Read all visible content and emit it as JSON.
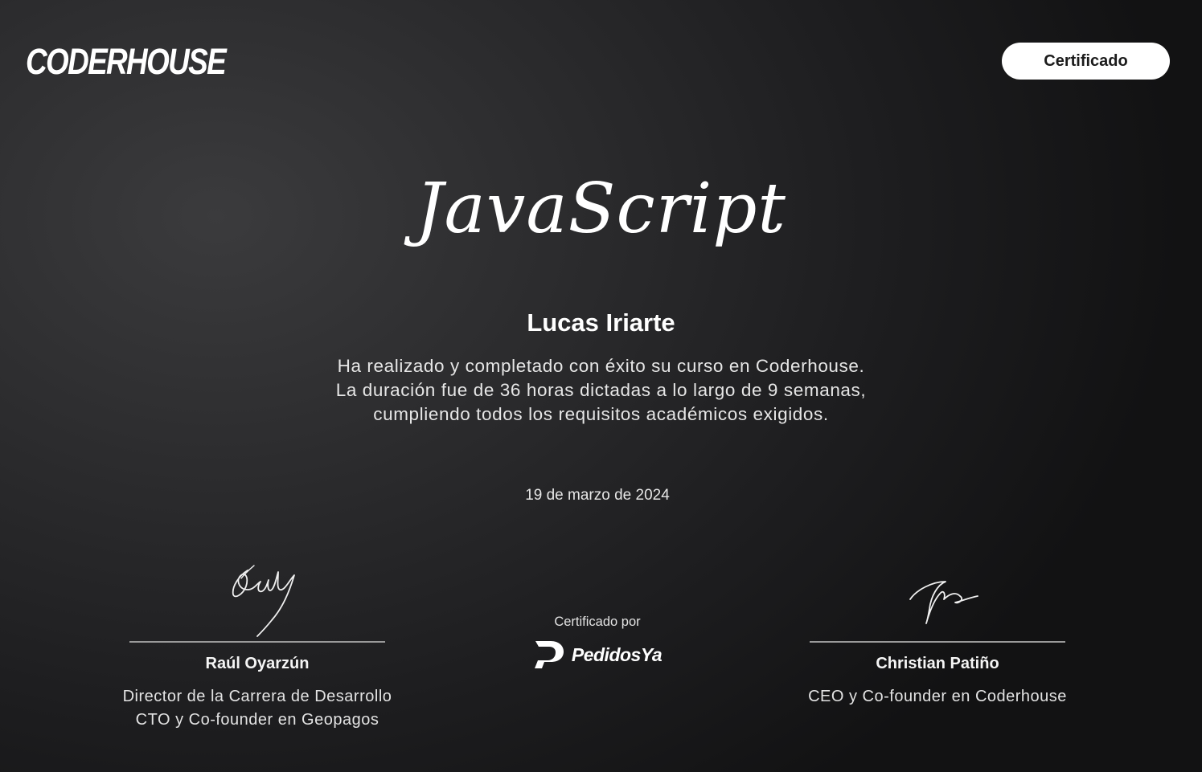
{
  "header": {
    "logo_text": "CODERHOUSE",
    "badge_label": "Certificado"
  },
  "certificate": {
    "course": "JavaScript",
    "student_name": "Lucas Iriarte",
    "description_lines": [
      "Ha realizado y completado con éxito su curso en Coderhouse.",
      "La duración fue de 36 horas dictadas a lo largo de 9 semanas,",
      "cumpliendo todos los requisitos académicos exigidos."
    ],
    "date": "19 de marzo de 2024"
  },
  "signatories": [
    {
      "name": "Raúl Oyarzún",
      "roles": [
        "Director de la Carrera de Desarrollo",
        "CTO y Co-founder en Geopagos"
      ]
    },
    {
      "name": "Christian Patiño",
      "roles": [
        "CEO y Co-founder en Coderhouse"
      ]
    }
  ],
  "sponsor": {
    "label": "Certificado por",
    "name": "PedidosYa"
  },
  "colors": {
    "background": "#2a2a2c",
    "text": "#ffffff",
    "badge_bg": "#ffffff",
    "badge_text": "#1b1b1b"
  }
}
